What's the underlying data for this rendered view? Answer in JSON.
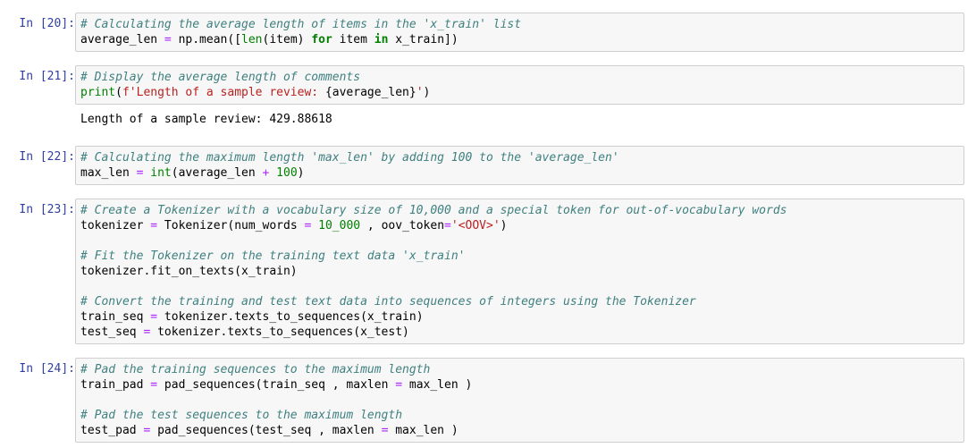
{
  "cells": [
    {
      "prompt": "In [20]:",
      "lines": [
        [
          {
            "t": "# Calculating the average length of items in the 'x_train' list",
            "c": "cm-comment"
          }
        ],
        [
          {
            "t": "average_len "
          },
          {
            "t": "=",
            "c": "cm-operator"
          },
          {
            "t": " np.mean(["
          },
          {
            "t": "len",
            "c": "cm-builtin"
          },
          {
            "t": "(item) "
          },
          {
            "t": "for",
            "c": "cm-keyword"
          },
          {
            "t": " item "
          },
          {
            "t": "in",
            "c": "cm-keyword"
          },
          {
            "t": " x_train])"
          }
        ]
      ]
    },
    {
      "prompt": "In [21]:",
      "lines": [
        [
          {
            "t": "# Display the average length of comments",
            "c": "cm-comment"
          }
        ],
        [
          {
            "t": "print",
            "c": "cm-builtin"
          },
          {
            "t": "("
          },
          {
            "t": "f'Length of a sample review: ",
            "c": "cm-string"
          },
          {
            "t": "{average_len}"
          },
          {
            "t": "'",
            "c": "cm-string"
          },
          {
            "t": ")"
          }
        ]
      ],
      "output": "Length of a sample review: 429.88618"
    },
    {
      "prompt": "In [22]:",
      "lines": [
        [
          {
            "t": "# Calculating the maximum length 'max_len' by adding 100 to the 'average_len'",
            "c": "cm-comment"
          }
        ],
        [
          {
            "t": "max_len "
          },
          {
            "t": "=",
            "c": "cm-operator"
          },
          {
            "t": " "
          },
          {
            "t": "int",
            "c": "cm-builtin"
          },
          {
            "t": "(average_len "
          },
          {
            "t": "+",
            "c": "cm-operator"
          },
          {
            "t": " "
          },
          {
            "t": "100",
            "c": "cm-number"
          },
          {
            "t": ")"
          }
        ]
      ]
    },
    {
      "prompt": "In [23]:",
      "lines": [
        [
          {
            "t": "# Create a Tokenizer with a vocabulary size of 10,000 and a special token for out-of-vocabulary words",
            "c": "cm-comment"
          }
        ],
        [
          {
            "t": "tokenizer "
          },
          {
            "t": "=",
            "c": "cm-operator"
          },
          {
            "t": " Tokenizer(num_words "
          },
          {
            "t": "=",
            "c": "cm-operator"
          },
          {
            "t": " "
          },
          {
            "t": "10_000",
            "c": "cm-number"
          },
          {
            "t": " , oov_token"
          },
          {
            "t": "=",
            "c": "cm-operator"
          },
          {
            "t": "'<OOV>'",
            "c": "cm-string"
          },
          {
            "t": ")"
          }
        ],
        [],
        [
          {
            "t": "# Fit the Tokenizer on the training text data 'x_train'",
            "c": "cm-comment"
          }
        ],
        [
          {
            "t": "tokenizer.fit_on_texts(x_train)"
          }
        ],
        [],
        [
          {
            "t": "# Convert the training and test text data into sequences of integers using the Tokenizer",
            "c": "cm-comment"
          }
        ],
        [
          {
            "t": "train_seq "
          },
          {
            "t": "=",
            "c": "cm-operator"
          },
          {
            "t": " tokenizer.texts_to_sequences(x_train)"
          }
        ],
        [
          {
            "t": "test_seq "
          },
          {
            "t": "=",
            "c": "cm-operator"
          },
          {
            "t": " tokenizer.texts_to_sequences(x_test)"
          }
        ]
      ]
    },
    {
      "prompt": "In [24]:",
      "lines": [
        [
          {
            "t": "# Pad the training sequences to the maximum length",
            "c": "cm-comment"
          }
        ],
        [
          {
            "t": "train_pad "
          },
          {
            "t": "=",
            "c": "cm-operator"
          },
          {
            "t": " pad_sequences(train_seq , maxlen "
          },
          {
            "t": "=",
            "c": "cm-operator"
          },
          {
            "t": " max_len )"
          }
        ],
        [],
        [
          {
            "t": "# Pad the test sequences to the maximum length",
            "c": "cm-comment"
          }
        ],
        [
          {
            "t": "test_pad "
          },
          {
            "t": "=",
            "c": "cm-operator"
          },
          {
            "t": " pad_sequences(test_seq , maxlen "
          },
          {
            "t": "=",
            "c": "cm-operator"
          },
          {
            "t": " max_len )"
          }
        ]
      ]
    }
  ]
}
